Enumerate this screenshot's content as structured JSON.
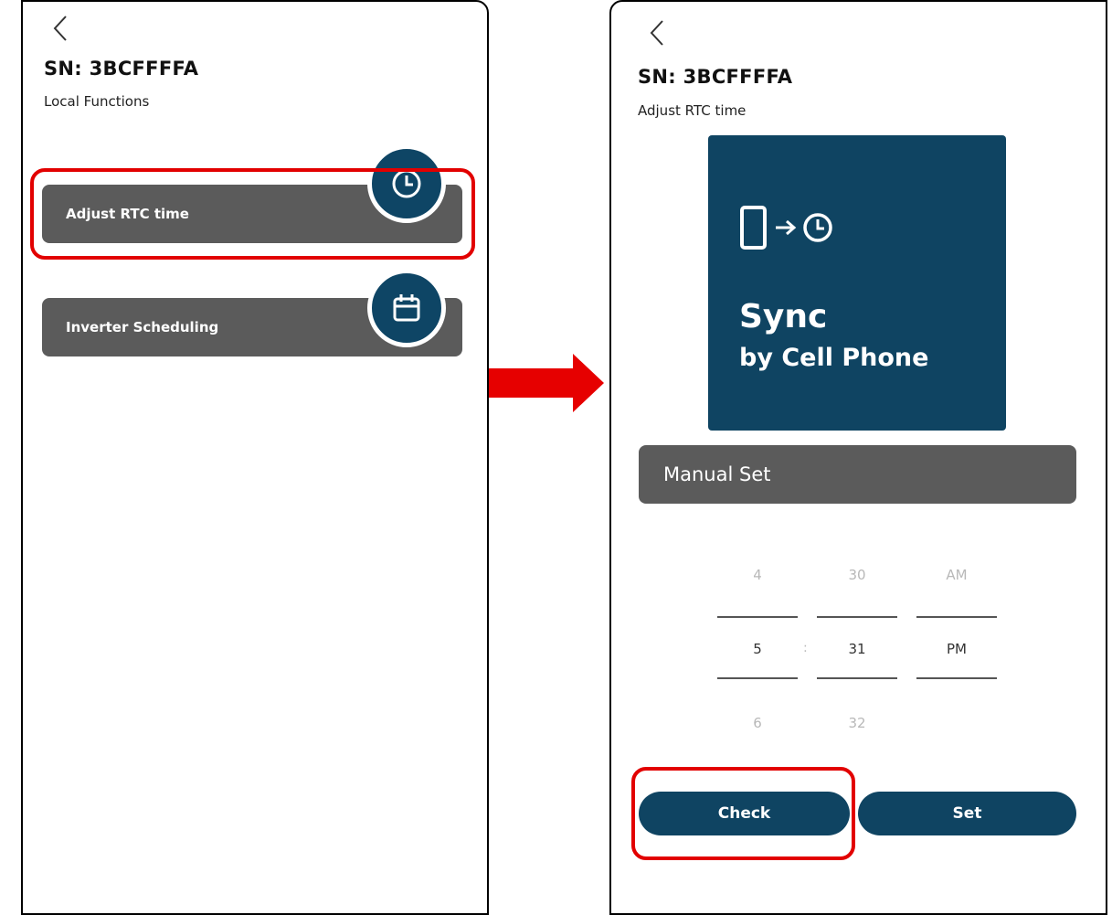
{
  "left_screen": {
    "serial": "SN: 3BCFFFFA",
    "subtitle": "Local Functions",
    "menu": [
      {
        "label": "Adjust RTC time",
        "icon": "clock-icon"
      },
      {
        "label": "Inverter Scheduling",
        "icon": "calendar-icon"
      }
    ]
  },
  "right_screen": {
    "serial": "SN: 3BCFFFFA",
    "subtitle": "Adjust RTC time",
    "sync_card": {
      "title": "Sync",
      "subtitle": "by Cell Phone",
      "icons": [
        "phone-icon",
        "arrow-right-icon",
        "clock-icon"
      ]
    },
    "manual_set_label": "Manual Set",
    "time_picker": {
      "hour": {
        "above": "4",
        "selected": "5",
        "below": "6"
      },
      "minute": {
        "above": "30",
        "selected": "31",
        "below": "32"
      },
      "period": {
        "above": "AM",
        "selected": "PM"
      },
      "separator": ":"
    },
    "buttons": {
      "check": "Check",
      "set": "Set"
    }
  },
  "colors": {
    "brand_navy": "#0f4462",
    "menu_gray": "#5b5b5b",
    "highlight_red": "#e20000"
  }
}
